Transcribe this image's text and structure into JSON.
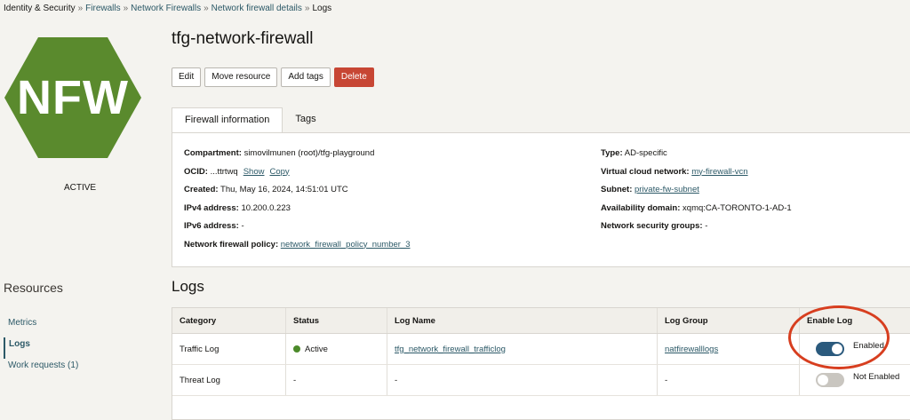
{
  "breadcrumb": [
    "Identity & Security",
    "Firewalls",
    "Network Firewalls",
    "Network firewall details",
    "Logs"
  ],
  "sidebar": {
    "icon_text": "NFW",
    "state": "ACTIVE",
    "resources_title": "Resources",
    "items": [
      {
        "label": "Metrics"
      },
      {
        "label": "Logs"
      },
      {
        "label": "Work requests (1)"
      }
    ]
  },
  "header": {
    "title": "tfg-network-firewall",
    "buttons": {
      "edit": "Edit",
      "move": "Move resource",
      "tags": "Add tags",
      "delete": "Delete"
    }
  },
  "tabs": {
    "firewall_info": "Firewall information",
    "tags": "Tags"
  },
  "info": {
    "compartment_label": "Compartment:",
    "compartment": "simovilmunen (root)/tfg-playground",
    "ocid_label": "OCID:",
    "ocid": "...ttrtwq",
    "show": "Show",
    "copy": "Copy",
    "created_label": "Created:",
    "created": "Thu, May 16, 2024, 14:51:01 UTC",
    "ipv4_label": "IPv4 address:",
    "ipv4": "10.200.0.223",
    "ipv6_label": "IPv6 address:",
    "ipv6": "-",
    "policy_label": "Network firewall policy:",
    "policy": "network_firewall_policy_number_3",
    "type_label": "Type:",
    "type": "AD-specific",
    "vcn_label": "Virtual cloud network:",
    "vcn": "my-firewall-vcn",
    "subnet_label": "Subnet:",
    "subnet": "private-fw-subnet",
    "ad_label": "Availability domain:",
    "ad": "xqmq:CA-TORONTO-1-AD-1",
    "nsg_label": "Network security groups:",
    "nsg": "-"
  },
  "logs": {
    "title": "Logs",
    "headers": [
      "Category",
      "Status",
      "Log Name",
      "Log Group",
      "Enable Log"
    ],
    "rows": [
      {
        "category": "Traffic Log",
        "status": "Active",
        "log_name": "tfg_network_firewall_trafficlog",
        "log_group": "natfirewalllogs",
        "enabled": true,
        "enable_label": "Enabled"
      },
      {
        "category": "Threat Log",
        "status": "-",
        "log_name": "-",
        "log_group": "-",
        "enabled": false,
        "enable_label": "Not Enabled"
      }
    ]
  },
  "colors": {
    "brand_green": "#5a8a2d",
    "link": "#2c5967",
    "delete": "#c74634",
    "toggle_on": "#2b5a7d",
    "highlight": "#d73e1f"
  }
}
